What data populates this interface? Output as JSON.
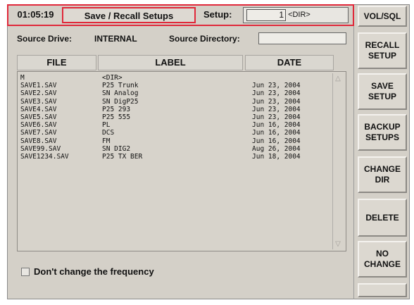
{
  "header": {
    "time": "01:05:19",
    "title": "Save / Recall Setups",
    "setup_label": "Setup:",
    "setup_number": "1",
    "setup_type": "<DIR>"
  },
  "source": {
    "drive_label": "Source Drive:",
    "drive_value": "INTERNAL",
    "directory_label": "Source Directory:",
    "directory_value": ""
  },
  "table": {
    "headers": [
      "FILE",
      "LABEL",
      "DATE"
    ],
    "rows": [
      {
        "file": "M",
        "label": "<DIR>",
        "date": ""
      },
      {
        "file": "SAVE1.SAV",
        "label": "P25 Trunk",
        "date": "Jun 23, 2004"
      },
      {
        "file": "SAVE2.SAV",
        "label": "SN Analog",
        "date": "Jun 23, 2004"
      },
      {
        "file": "SAVE3.SAV",
        "label": "SN DigP25",
        "date": "Jun 23, 2004"
      },
      {
        "file": "SAVE4.SAV",
        "label": "P25 293",
        "date": "Jun 23, 2004"
      },
      {
        "file": "SAVE5.SAV",
        "label": "P25 555",
        "date": "Jun 23, 2004"
      },
      {
        "file": "SAVE6.SAV",
        "label": "PL",
        "date": "Jun 16, 2004"
      },
      {
        "file": "SAVE7.SAV",
        "label": "DCS",
        "date": "Jun 16, 2004"
      },
      {
        "file": "SAVE8.SAV",
        "label": "FM",
        "date": "Jun 16, 2004"
      },
      {
        "file": "SAVE99.SAV",
        "label": "SN DIG2",
        "date": "Aug 26, 2004"
      },
      {
        "file": "SAVE1234.SAV",
        "label": "P25 TX BER",
        "date": "Jun 18, 2004"
      }
    ]
  },
  "checkbox": {
    "label": "Don't change the frequency",
    "checked": false
  },
  "softkeys": {
    "vol_sql": "VOL/SQL",
    "recall_1": "RECALL",
    "recall_2": "SETUP",
    "save_1": "SAVE",
    "save_2": "SETUP",
    "backup_1": "BACKUP",
    "backup_2": "SETUPS",
    "change_dir_1": "CHANGE",
    "change_dir_2": "DIR",
    "delete": "DELETE",
    "no_change_1": "NO",
    "no_change_2": "CHANGE",
    "blank": ""
  },
  "colors": {
    "highlight": "#e0283a",
    "panel": "#d4d0c8"
  }
}
